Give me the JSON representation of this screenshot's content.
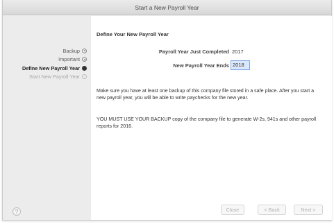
{
  "window": {
    "title": "Start a New Payroll Year"
  },
  "sidebar": {
    "steps": [
      {
        "label": "Backup",
        "state": "done"
      },
      {
        "label": "Important",
        "state": "done"
      },
      {
        "label": "Define New Payroll Year",
        "state": "active"
      },
      {
        "label": "Start New Payroll Year",
        "state": "future"
      }
    ],
    "help_label": "?"
  },
  "main": {
    "heading": "Define Your New Payroll Year",
    "fields": {
      "completed_label": "Payroll Year Just Completed",
      "completed_value": "2017",
      "ends_label": "New Payroll Year Ends",
      "ends_value": "2018"
    },
    "paragraph1": "Make sure you have at least one backup of this company file stored in a safe place. After you start a new payroll year, you will be able to write paychecks for the new year.",
    "paragraph2": "YOU MUST USE YOUR BACKUP copy of the company file to generate W-2s, 941s and other payroll reports for 2016."
  },
  "buttons": {
    "close": "Close",
    "back": "< Back",
    "next": "Next >"
  }
}
